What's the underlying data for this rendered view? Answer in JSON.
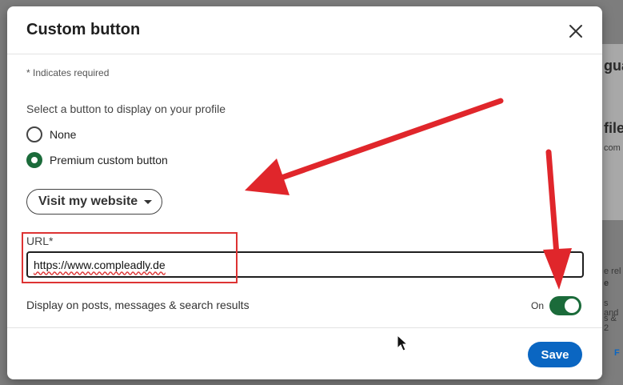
{
  "background": {
    "right_texts": [
      "gua",
      "file",
      "com",
      "e rel",
      "e",
      "s and",
      "s & 2",
      "F"
    ]
  },
  "modal": {
    "title": "Custom button",
    "close_icon": "close-icon",
    "required_note": "* Indicates required",
    "select_label": "Select a button to display on your profile",
    "options": [
      {
        "label": "None",
        "checked": false
      },
      {
        "label": "Premium custom button",
        "checked": true
      }
    ],
    "dropdown": {
      "selected": "Visit my website",
      "icon": "chevron-down-icon"
    },
    "url": {
      "label": "URL*",
      "value": "https://www.compleadly.de"
    },
    "display_toggle": {
      "label": "Display on posts, messages & search results",
      "state_text": "On",
      "on": true
    },
    "save_label": "Save"
  },
  "annotation": {
    "color": "#e0262b"
  },
  "colors": {
    "primary": "#0a66c2",
    "toggle_on": "#1b6b3a",
    "radio_checked": "#1b6b3a"
  }
}
